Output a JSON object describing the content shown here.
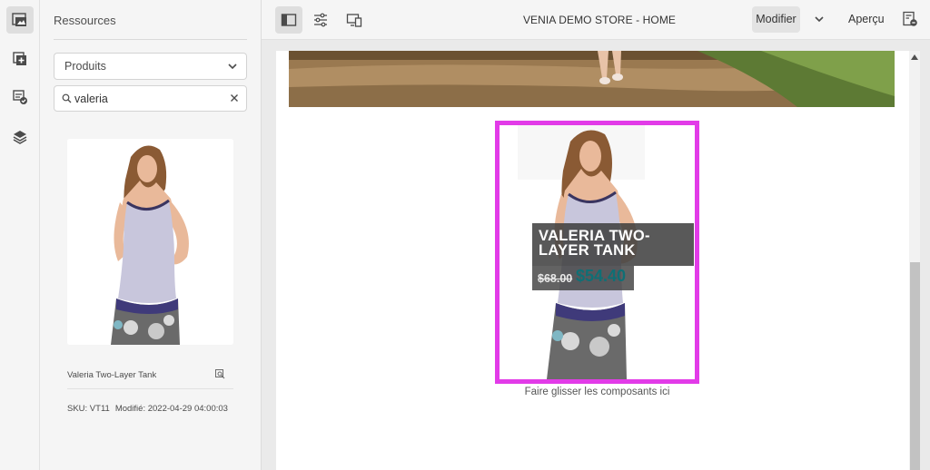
{
  "rail": {
    "items": [
      {
        "name": "asset-finder",
        "active": true
      },
      {
        "name": "components"
      },
      {
        "name": "content-tree-check"
      },
      {
        "name": "layers"
      }
    ]
  },
  "panel": {
    "title": "Ressources",
    "asset_type": "Produits",
    "search": {
      "value": "valeria",
      "placeholder": ""
    },
    "product": {
      "name": "Valeria Two-Layer Tank",
      "sku": "SKU: VT11",
      "modified": "Modifié: 2022-04-29 04:00:03"
    }
  },
  "toolbar": {
    "page_name": "VENIA DEMO STORE - HOME",
    "mode": "Modifier",
    "preview": "Aperçu"
  },
  "canvas": {
    "teaser": {
      "title": "VALERIA TWO-LAYER TANK",
      "price_old": "$68.00",
      "price_new": "$54.40"
    },
    "drop_hint": "Faire glisser les composants ici"
  },
  "colors": {
    "selection": "#e23be8",
    "price": "#0f6f75"
  }
}
